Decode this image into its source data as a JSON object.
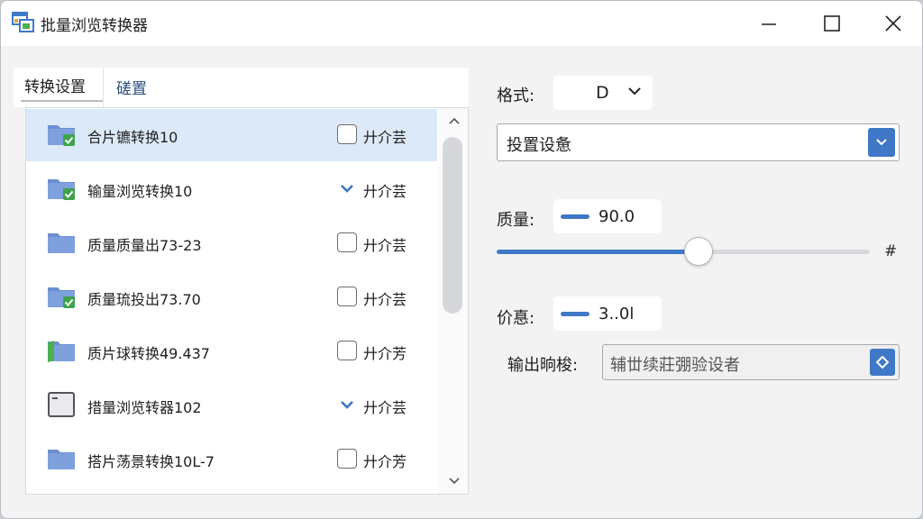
{
  "window": {
    "title": "批量浏览转换器",
    "accent": "#3f78c6"
  },
  "tabs": [
    {
      "label": "转换设置",
      "active": true
    },
    {
      "label": "磋置",
      "active": false
    }
  ],
  "list": {
    "items": [
      {
        "label": "合片镳转换10",
        "control": "checkbox",
        "control_text": "廾介芸",
        "selected": true,
        "folder_icon": "folder-check-icon"
      },
      {
        "label": "输量浏览转换10",
        "control": "chevron",
        "control_text": "廾介芸",
        "selected": false,
        "folder_icon": "folder-check-icon"
      },
      {
        "label": "质量质量出73-23",
        "control": "checkbox",
        "control_text": "廾介芸",
        "selected": false,
        "folder_icon": "folder-icon"
      },
      {
        "label": "质量琉投出73.70",
        "control": "checkbox",
        "control_text": "廾介芸",
        "selected": false,
        "folder_icon": "folder-check-icon"
      },
      {
        "label": "质片球转换49.437",
        "control": "checkbox",
        "control_text": "廾介芳",
        "selected": false,
        "folder_icon": "folder-green-icon"
      },
      {
        "label": "措量浏览转器102",
        "control": "chevron",
        "control_text": "廾介芸",
        "selected": false,
        "folder_icon": "document-icon"
      },
      {
        "label": "搭片荡景转换10L-7",
        "control": "checkbox",
        "control_text": "廾介芳",
        "selected": false,
        "folder_icon": "folder-icon"
      }
    ]
  },
  "settings": {
    "format_label": "格式:",
    "format_value": "D",
    "preset_value": "投置设惫",
    "quality_label": "质量:",
    "quality_value": "90.0",
    "quality_slider_fraction": 0.54,
    "slider_end_label": "#",
    "price_label": "价惪:",
    "price_value": "3..0l",
    "output_label": "输出晌梭:",
    "output_placeholder": "辅丗续莊弸验设者"
  }
}
